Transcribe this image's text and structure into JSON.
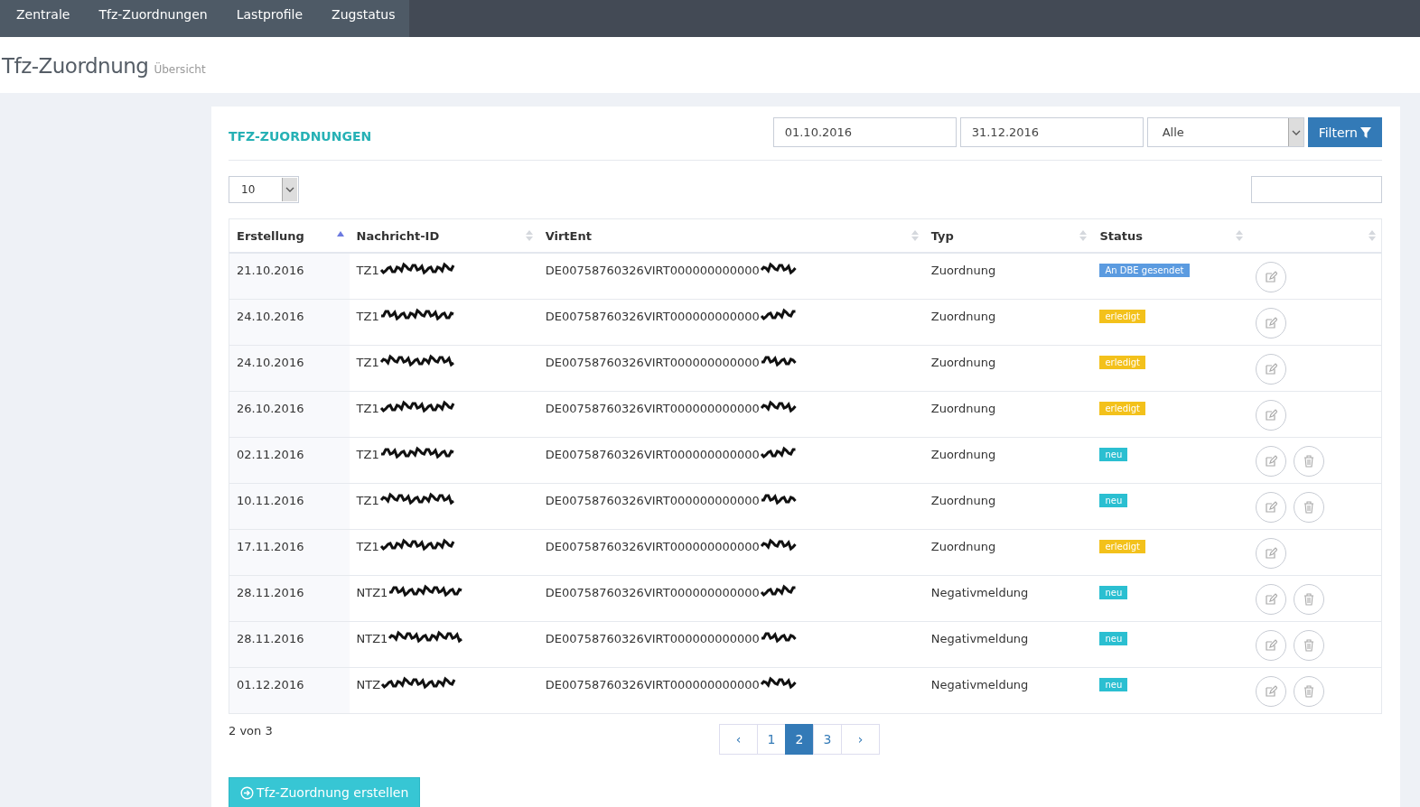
{
  "nav": {
    "items": [
      {
        "label": "Zentrale"
      },
      {
        "label": "Tfz-Zuordnungen"
      },
      {
        "label": "Lastprofile"
      },
      {
        "label": "Zugstatus"
      }
    ]
  },
  "page_header": {
    "title": "Tfz-Zuordnung",
    "subtitle": "Übersicht"
  },
  "panel": {
    "title": "TFZ-ZUORDNUNGEN",
    "filters": {
      "date_from": "01.10.2016",
      "date_to": "31.12.2016",
      "type_select": "Alle",
      "button": "Filtern"
    },
    "page_size": "10",
    "table": {
      "columns": [
        {
          "label": "Erstellung",
          "sorted": true
        },
        {
          "label": "Nachricht-ID",
          "sorted": false
        },
        {
          "label": "VirtEnt",
          "sorted": false
        },
        {
          "label": "Typ",
          "sorted": false
        },
        {
          "label": "Status",
          "sorted": false
        },
        {
          "sorted": false
        }
      ],
      "rows": [
        {
          "date": "21.10.2016",
          "message_id": {
            "text": "TZ1",
            "redacted": true
          },
          "virtent": {
            "text": "DE00758760326VIRT000000000000",
            "redacted": true
          },
          "type": "Zuordnung",
          "status": {
            "label": "An DBE gesendet",
            "color": "#5b9be0"
          },
          "deletable": false
        },
        {
          "date": "24.10.2016",
          "message_id": {
            "text": "TZ1",
            "redacted": true
          },
          "virtent": {
            "text": "DE00758760326VIRT000000000000",
            "redacted": true
          },
          "type": "Zuordnung",
          "status": {
            "label": "erledigt",
            "color": "#f3c11b"
          },
          "deletable": false
        },
        {
          "date": "24.10.2016",
          "message_id": {
            "text": "TZ1",
            "redacted": true
          },
          "virtent": {
            "text": "DE00758760326VIRT000000000000",
            "redacted": true
          },
          "type": "Zuordnung",
          "status": {
            "label": "erledigt",
            "color": "#f3c11b"
          },
          "deletable": false
        },
        {
          "date": "26.10.2016",
          "message_id": {
            "text": "TZ1",
            "redacted": true
          },
          "virtent": {
            "text": "DE00758760326VIRT000000000000",
            "redacted": true
          },
          "type": "Zuordnung",
          "status": {
            "label": "erledigt",
            "color": "#f3c11b"
          },
          "deletable": false
        },
        {
          "date": "02.11.2016",
          "message_id": {
            "text": "TZ1",
            "redacted": true
          },
          "virtent": {
            "text": "DE00758760326VIRT000000000000",
            "redacted": true
          },
          "type": "Zuordnung",
          "status": {
            "label": "neu",
            "color": "#2bbfd1"
          },
          "deletable": true
        },
        {
          "date": "10.11.2016",
          "message_id": {
            "text": "TZ1",
            "redacted": true
          },
          "virtent": {
            "text": "DE00758760326VIRT000000000000",
            "redacted": true
          },
          "type": "Zuordnung",
          "status": {
            "label": "neu",
            "color": "#2bbfd1"
          },
          "deletable": true
        },
        {
          "date": "17.11.2016",
          "message_id": {
            "text": "TZ1",
            "redacted": true
          },
          "virtent": {
            "text": "DE00758760326VIRT000000000000",
            "redacted": true
          },
          "type": "Zuordnung",
          "status": {
            "label": "erledigt",
            "color": "#f3c11b"
          },
          "deletable": false
        },
        {
          "date": "28.11.2016",
          "message_id": {
            "text": "NTZ1",
            "redacted": true
          },
          "virtent": {
            "text": "DE00758760326VIRT000000000000",
            "redacted": true
          },
          "type": "Negativmeldung",
          "status": {
            "label": "neu",
            "color": "#2bbfd1"
          },
          "deletable": true
        },
        {
          "date": "28.11.2016",
          "message_id": {
            "text": "NTZ1",
            "redacted": true
          },
          "virtent": {
            "text": "DE00758760326VIRT000000000000",
            "redacted": true
          },
          "type": "Negativmeldung",
          "status": {
            "label": "neu",
            "color": "#2bbfd1"
          },
          "deletable": true
        },
        {
          "date": "01.12.2016",
          "message_id": {
            "text": "NTZ",
            "redacted": true
          },
          "virtent": {
            "text": "DE00758760326VIRT000000000000",
            "redacted": true
          },
          "type": "Negativmeldung",
          "status": {
            "label": "neu",
            "color": "#2bbfd1"
          },
          "deletable": true
        }
      ]
    },
    "page_info": "2 von 3",
    "pagination": [
      {
        "label": "‹",
        "selected": false
      },
      {
        "label": "1",
        "selected": false
      },
      {
        "label": "2",
        "selected": true
      },
      {
        "label": "3",
        "selected": false
      },
      {
        "label": "›",
        "selected": false
      }
    ],
    "create_button": "Tfz-Zuordnung erstellen"
  }
}
